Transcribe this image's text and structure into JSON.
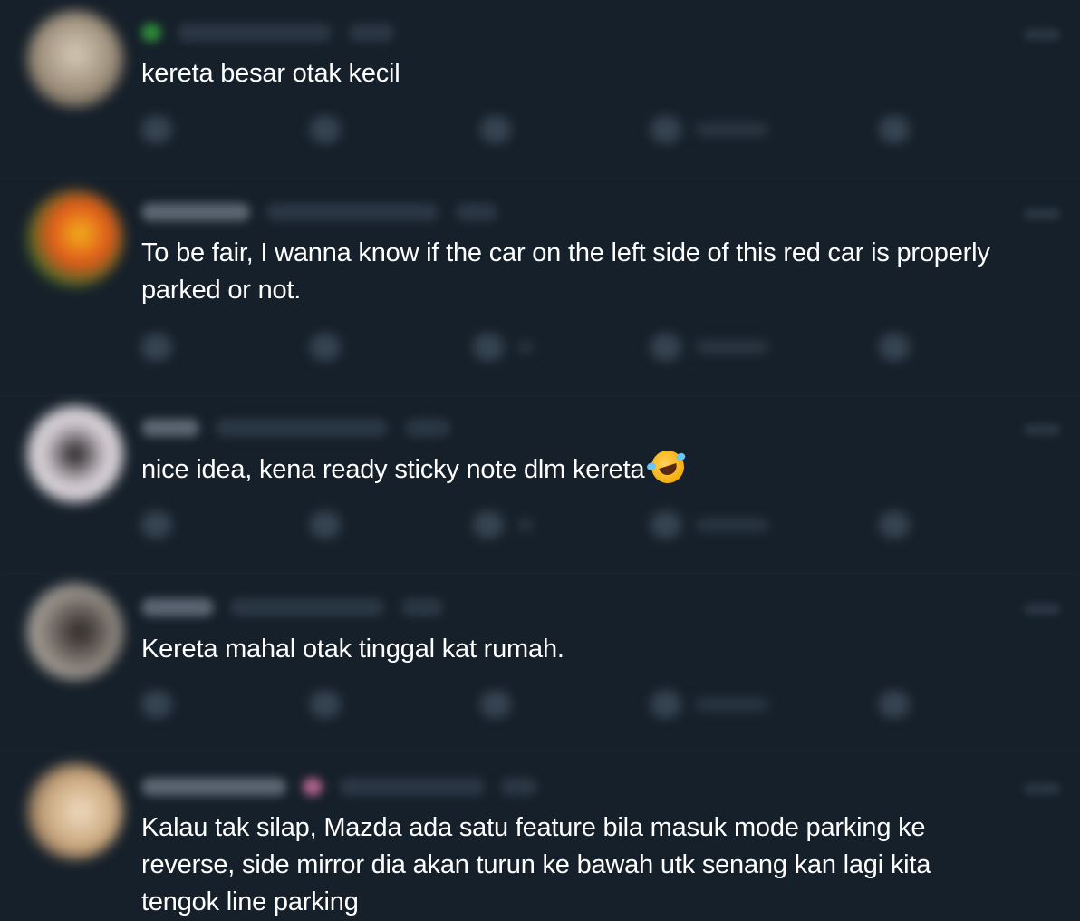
{
  "replies": [
    {
      "text": "kereta besar otak kecil"
    },
    {
      "text": "To be fair, I wanna know if the car on the left side of this red car is properly parked or not."
    },
    {
      "text": "nice idea, kena ready sticky note dlm kereta",
      "emoji": "rolling-on-floor-laughing"
    },
    {
      "text": "Kereta mahal otak tinggal kat rumah."
    },
    {
      "text": "Kalau tak silap, Mazda ada satu feature bila masuk mode parking ke reverse, side mirror dia akan turun ke bawah utk senang kan lagi kita tengok line parking"
    }
  ],
  "colors": {
    "background": "#16202a",
    "text": "#ffffff",
    "muted": "#364452"
  }
}
